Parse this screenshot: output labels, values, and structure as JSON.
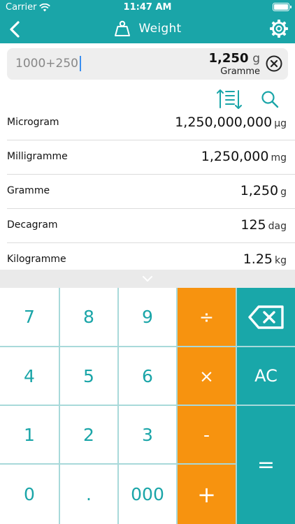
{
  "status_bar": {
    "carrier": "Carrier",
    "time": "11:47 AM"
  },
  "nav": {
    "title": "Weight",
    "back_icon": "chevron-left-icon",
    "title_icon": "weight-icon",
    "settings_icon": "gear-icon"
  },
  "input": {
    "expression": "1000+250",
    "result_value": "1,250",
    "result_unit": "g",
    "result_unit_name": "Gramme",
    "clear_icon": "clear-circle-icon"
  },
  "tools": {
    "sort_icon": "sort-icon",
    "search_icon": "search-icon"
  },
  "units": [
    {
      "name": "Microgram",
      "value": "1,250,000,000",
      "unit": "µg"
    },
    {
      "name": "Milligramme",
      "value": "1,250,000",
      "unit": "mg"
    },
    {
      "name": "Gramme",
      "value": "1,250",
      "unit": "g"
    },
    {
      "name": "Decagram",
      "value": "125",
      "unit": "dag"
    },
    {
      "name": "Kilogramme",
      "value": "1.25",
      "unit": "kg"
    }
  ],
  "keypad": {
    "k7": "7",
    "k8": "8",
    "k9": "9",
    "divide": "÷",
    "k4": "4",
    "k5": "5",
    "k6": "6",
    "multiply": "×",
    "ac": "AC",
    "k1": "1",
    "k2": "2",
    "k3": "3",
    "minus": "-",
    "k0": "0",
    "dot": ".",
    "k000": "000",
    "plus": "+",
    "equals": "=",
    "backspace_icon": "backspace-icon",
    "colors": {
      "teal": "#1aa5a8",
      "orange": "#f7930f",
      "grid": "#a8d9da"
    }
  }
}
